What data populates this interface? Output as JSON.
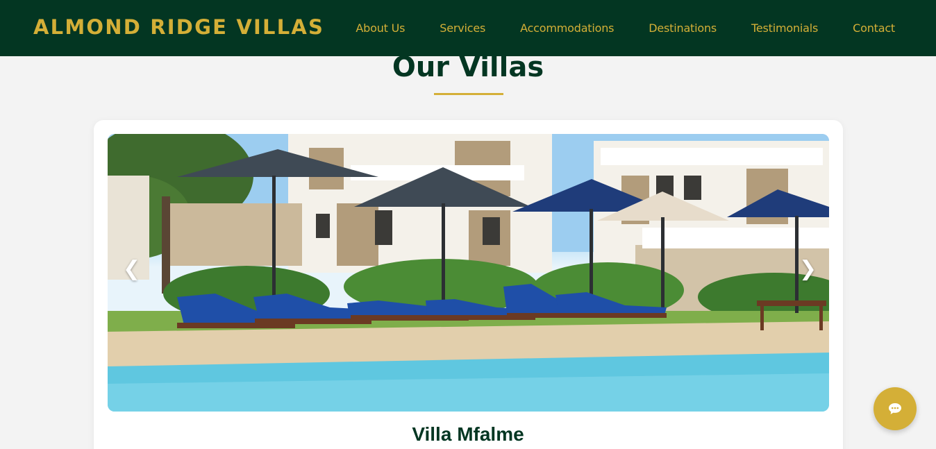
{
  "brand": {
    "name": "ALMOND RIDGE VILLAS"
  },
  "nav": {
    "items": [
      {
        "label": "About Us"
      },
      {
        "label": "Services"
      },
      {
        "label": "Accommodations"
      },
      {
        "label": "Destinations"
      },
      {
        "label": "Testimonials"
      },
      {
        "label": "Contact"
      }
    ]
  },
  "section": {
    "title": "Our Villas"
  },
  "slider": {
    "prev_label": "❮",
    "next_label": "❯",
    "image_alt": "Villa pool with sun loungers and umbrellas"
  },
  "villa": {
    "name": "Villa Mfalme"
  },
  "chat": {
    "icon": "chat-bubble-icon"
  },
  "colors": {
    "primary_green": "#033622",
    "accent_gold": "#d4af37",
    "background": "#f3f3f3"
  }
}
